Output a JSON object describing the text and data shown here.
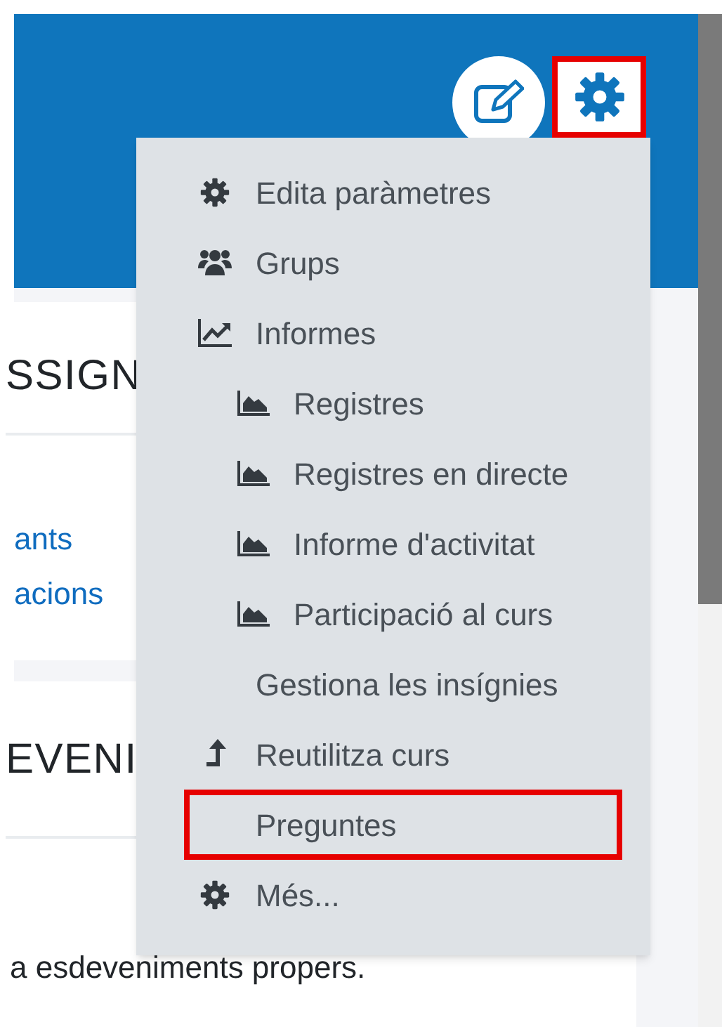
{
  "header": {
    "settings_button": {
      "highlighted": true
    }
  },
  "blocks": [
    {
      "heading": "SSIGN",
      "links": [
        "ants",
        "acions"
      ]
    },
    {
      "heading": "EVENI",
      "text": "a esdeveniments propers."
    }
  ],
  "menu": {
    "items": [
      {
        "kind": "gear",
        "label": "Edita paràmetres",
        "highlighted": false
      },
      {
        "kind": "users",
        "label": "Grups",
        "highlighted": false
      },
      {
        "kind": "line-chart",
        "label": "Informes",
        "highlighted": false,
        "children": [
          {
            "kind": "area-chart",
            "label": "Registres",
            "highlighted": false
          },
          {
            "kind": "area-chart",
            "label": "Registres en directe",
            "highlighted": false
          },
          {
            "kind": "area-chart",
            "label": "Informe d'activitat",
            "highlighted": false
          },
          {
            "kind": "area-chart",
            "label": "Participació al curs",
            "highlighted": false
          }
        ]
      },
      {
        "kind": "plain",
        "label": "Gestiona les insígnies",
        "highlighted": false
      },
      {
        "kind": "upload",
        "label": "Reutilitza curs",
        "highlighted": false
      },
      {
        "kind": "plain",
        "label": "Preguntes",
        "highlighted": true
      },
      {
        "kind": "gear",
        "label": "Més...",
        "highlighted": false
      }
    ]
  }
}
